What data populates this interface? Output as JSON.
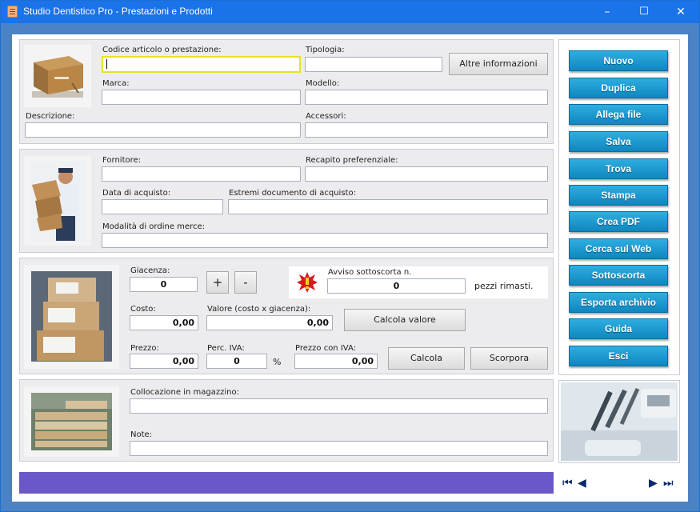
{
  "window": {
    "title": "Studio Dentistico Pro - Prestazioni e Prodotti",
    "minimize": "–",
    "maximize": "☐",
    "close": "✕"
  },
  "section1": {
    "codice_label": "Codice articolo o prestazione:",
    "tipologia_label": "Tipologia:",
    "altre_info_button": "Altre informazioni",
    "marca_label": "Marca:",
    "modello_label": "Modello:",
    "descrizione_label": "Descrizione:",
    "accessori_label": "Accessori:"
  },
  "section2": {
    "fornitore_label": "Fornitore:",
    "recapito_label": "Recapito preferenziale:",
    "data_acquisto_label": "Data di acquisto:",
    "estremi_label": "Estremi documento di acquisto:",
    "modalita_label": "Modalità di ordine merce:"
  },
  "section3": {
    "giacenza_label": "Giacenza:",
    "giacenza_value": "0",
    "plus_button": "+",
    "minus_button": "-",
    "avviso_label": "Avviso sottoscorta n.",
    "avviso_value": "0",
    "pezzi_label": "pezzi rimasti.",
    "costo_label": "Costo:",
    "costo_value": "0,00",
    "valore_label": "Valore (costo x giacenza):",
    "valore_value": "0,00",
    "calcola_valore_button": "Calcola valore",
    "prezzo_label": "Prezzo:",
    "prezzo_value": "0,00",
    "perc_iva_label": "Perc. IVA:",
    "perc_iva_value": "0",
    "percent_sign": "%",
    "prezzo_iva_label": "Prezzo con IVA:",
    "prezzo_iva_value": "0,00",
    "calcola_button": "Calcola",
    "scorpora_button": "Scorpora"
  },
  "section4": {
    "collocazione_label": "Collocazione in magazzino:",
    "note_label": "Note:"
  },
  "sidebar": {
    "buttons": [
      "Nuovo",
      "Duplica",
      "Allega file",
      "Salva",
      "Trova",
      "Stampa",
      "Crea PDF",
      "Cerca sul Web",
      "Sottoscorta",
      "Esporta archivio",
      "Guida",
      "Esci"
    ]
  },
  "navigation": {
    "first": "⏮",
    "prev": "◀",
    "next": "▶",
    "last": "⏭"
  },
  "colors": {
    "title_bar": "#1a73e8",
    "nav_button": "#1a9bd3",
    "status_bar": "#6a58c8",
    "focus_border": "#e9e02a"
  }
}
